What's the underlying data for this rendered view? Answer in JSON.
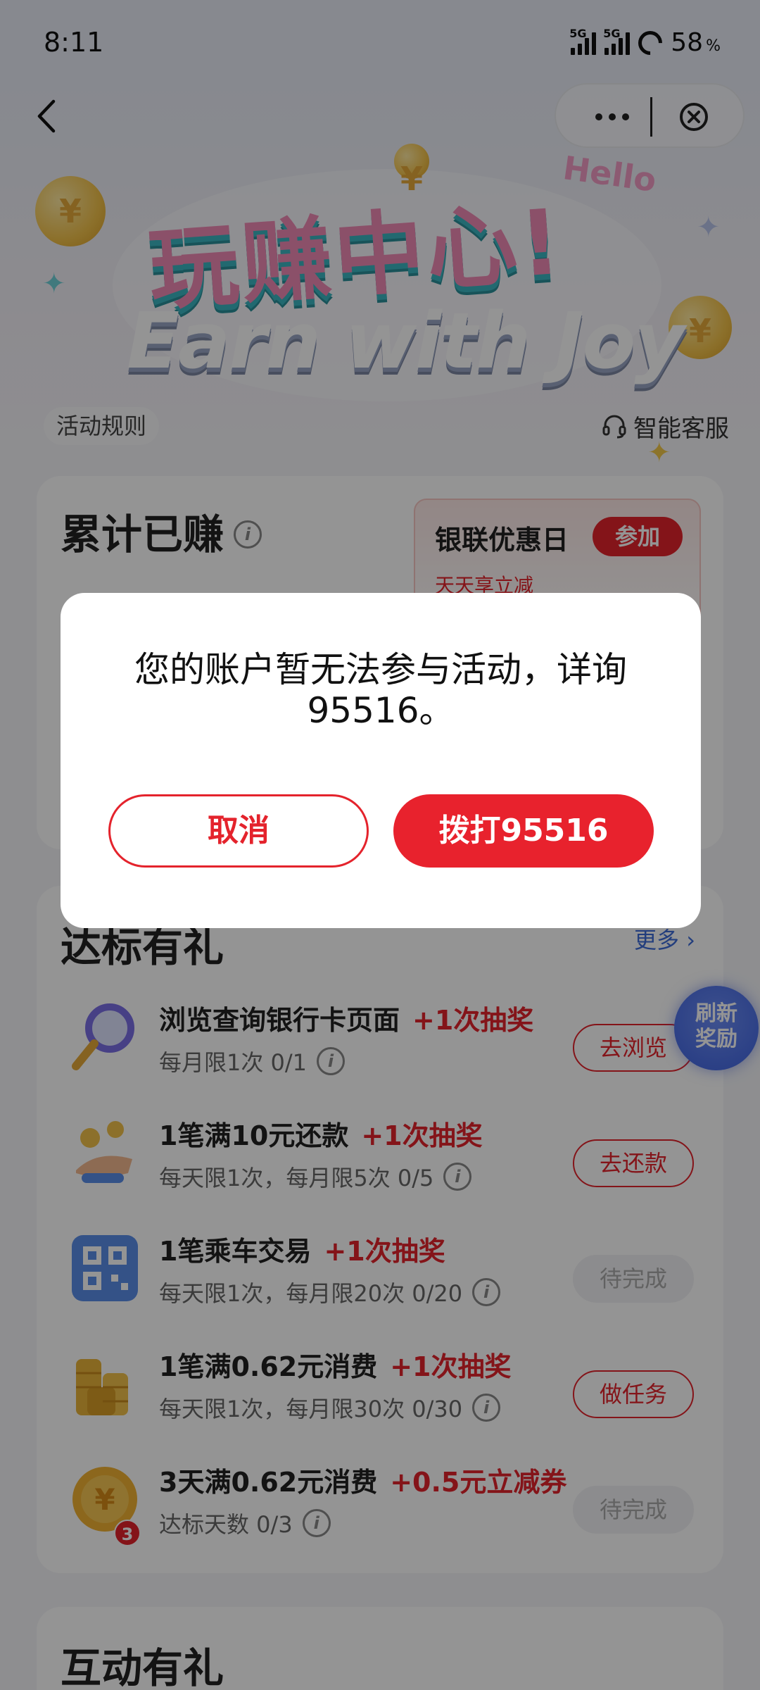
{
  "status_bar": {
    "time": "8:11",
    "network_1": "5G",
    "network_2": "5G",
    "battery": "58",
    "battery_unit": "%"
  },
  "hero": {
    "title_cn": "玩赚中心!",
    "title_en": "Earn with Joy",
    "hello": "Hello",
    "rules_label": "活动规则",
    "service_label": "智能客服"
  },
  "earned": {
    "title": "累计已赚",
    "promo_title": "银联优惠日",
    "promo_join": "参加",
    "promo_sub": "天天享立减"
  },
  "tasks": {
    "title": "达标有礼",
    "more": "更多 ›",
    "items": [
      {
        "name": "浏览查询银行卡页面",
        "reward": "+1次抽奖",
        "limit": "每月限1次  0/1",
        "button": "去浏览",
        "icon": "magnifier-icon"
      },
      {
        "name": "1笔满10元还款",
        "reward": "+1次抽奖",
        "limit": "每天限1次，每月限5次  0/5",
        "button": "去还款",
        "icon": "hand-coin-icon"
      },
      {
        "name": "1笔乘车交易",
        "reward": "+1次抽奖",
        "limit": "每天限1次，每月限20次  0/20",
        "button": "待完成",
        "icon": "qr-code-icon"
      },
      {
        "name": "1笔满0.62元消费",
        "reward": "+1次抽奖",
        "limit": "每天限1次，每月限30次  0/30",
        "button": "做任务",
        "icon": "coin-stack-icon"
      },
      {
        "name": "3天满0.62元消费",
        "reward": "+0.5元立减券",
        "limit": "达标天数 0/3",
        "button": "待完成",
        "icon": "yuan-coin-icon",
        "badge": "3"
      }
    ]
  },
  "refresh_bubble": "刷新\n奖励",
  "interact": {
    "title": "互动有礼"
  },
  "dialog": {
    "message": "您的账户暂无法参与活动，详询95516。",
    "cancel_label": "取消",
    "call_label": "拨打95516"
  },
  "colors": {
    "accent_red": "#e4232c",
    "link_blue": "#3d6bd8"
  }
}
